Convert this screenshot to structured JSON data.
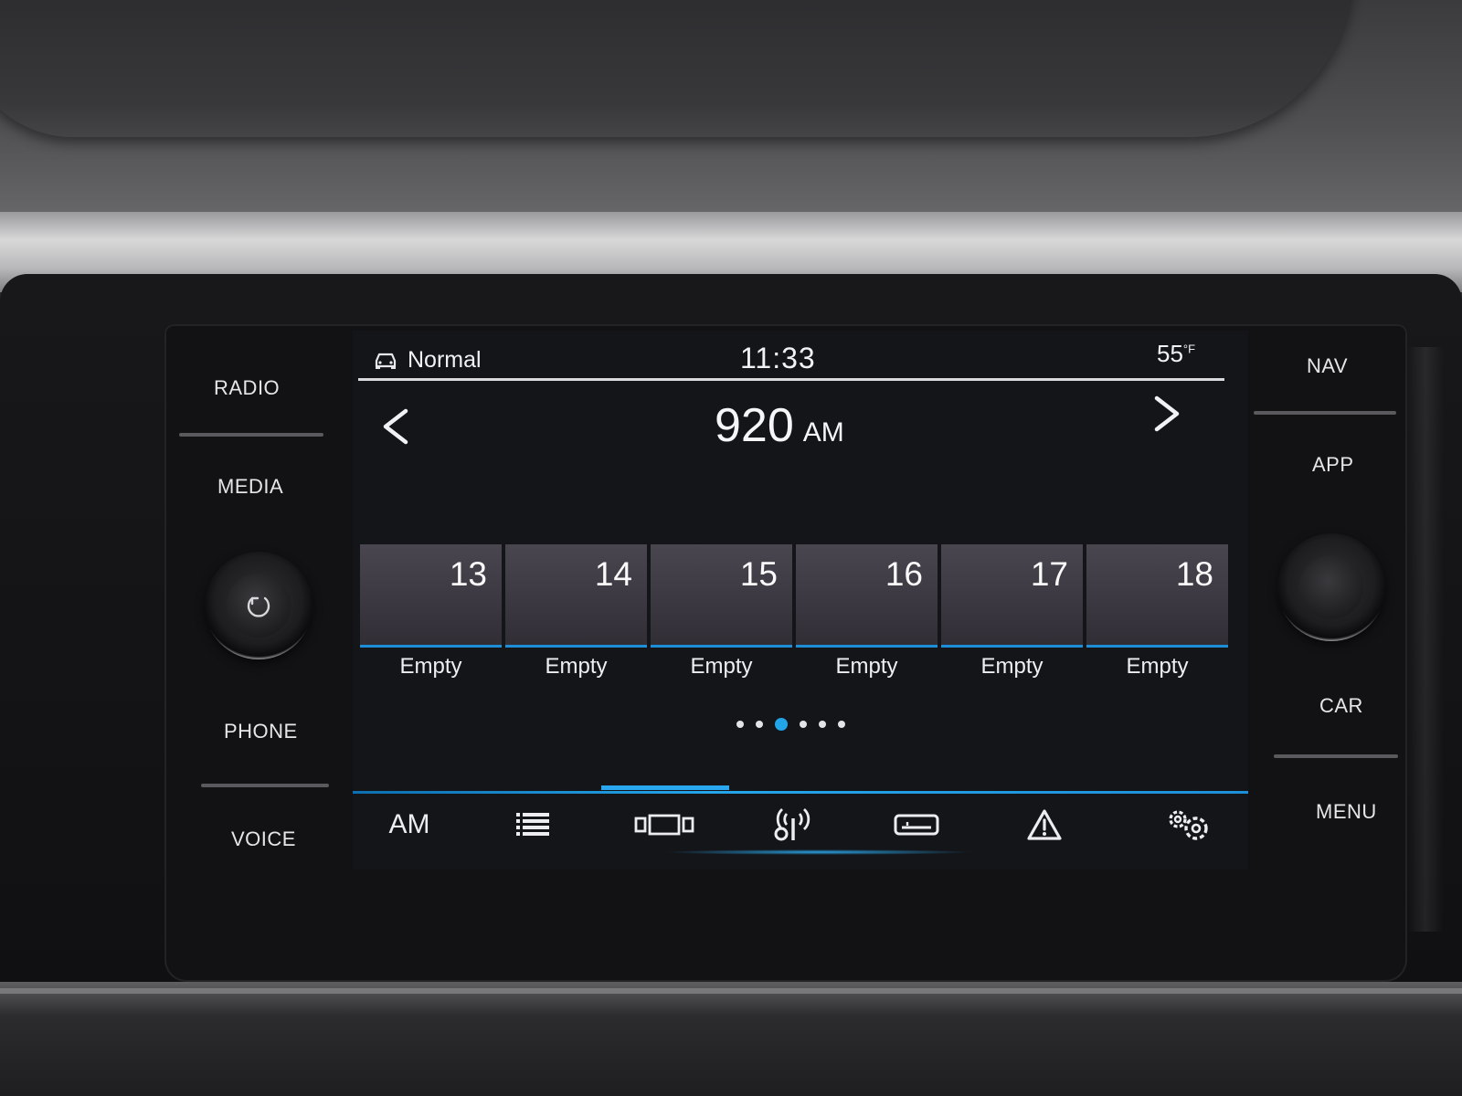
{
  "status_bar": {
    "drive_mode": "Normal",
    "time": "11:33",
    "temperature": "55",
    "temperature_unit": "°F"
  },
  "tuner": {
    "frequency": "920",
    "band_unit": "AM"
  },
  "presets": [
    {
      "number": "13",
      "label": "Empty"
    },
    {
      "number": "14",
      "label": "Empty"
    },
    {
      "number": "15",
      "label": "Empty"
    },
    {
      "number": "16",
      "label": "Empty"
    },
    {
      "number": "17",
      "label": "Empty"
    },
    {
      "number": "18",
      "label": "Empty"
    }
  ],
  "page_indicator": {
    "count": 6,
    "active_index": 2
  },
  "toolbar": {
    "band_label": "AM",
    "items": [
      "list-icon",
      "presets-view-icon",
      "scan-icon",
      "traffic-icon",
      "warning-icon",
      "settings-icon"
    ]
  },
  "left_buttons": {
    "radio": "RADIO",
    "media": "MEDIA",
    "phone": "PHONE",
    "voice": "VOICE"
  },
  "right_buttons": {
    "nav": "NAV",
    "app": "APP",
    "car": "CAR",
    "menu": "MENU"
  },
  "colors": {
    "accent": "#22a4e8",
    "preset_underline": "#1e8fd6"
  }
}
